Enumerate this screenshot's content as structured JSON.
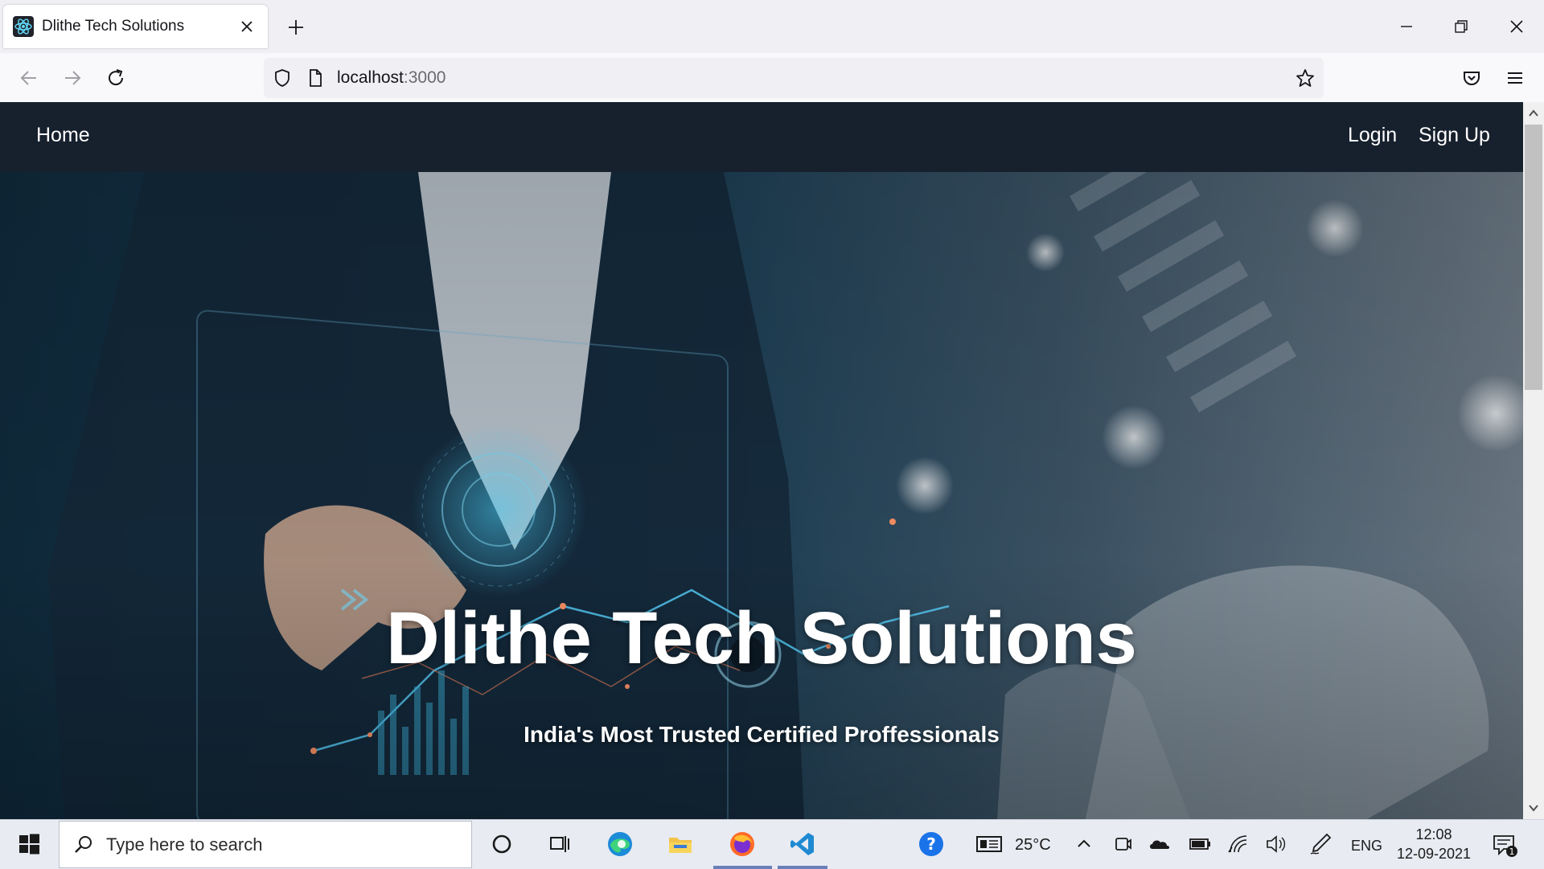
{
  "browser": {
    "tab_title": "Dlithe Tech Solutions",
    "url_host": "localhost",
    "url_port": ":3000"
  },
  "site": {
    "nav": {
      "home": "Home",
      "login": "Login",
      "signup": "Sign Up"
    },
    "hero": {
      "title": "Dlithe Tech Solutions",
      "subtitle": "India's Most Trusted Certified Proffessionals"
    }
  },
  "taskbar": {
    "search_placeholder": "Type here to search",
    "weather": "25°C",
    "language": "ENG",
    "time": "12:08",
    "date": "12-09-2021",
    "notification_count": "1"
  },
  "colors": {
    "site_nav_bg": "#17202d",
    "accent_blue": "#0a84ff"
  }
}
